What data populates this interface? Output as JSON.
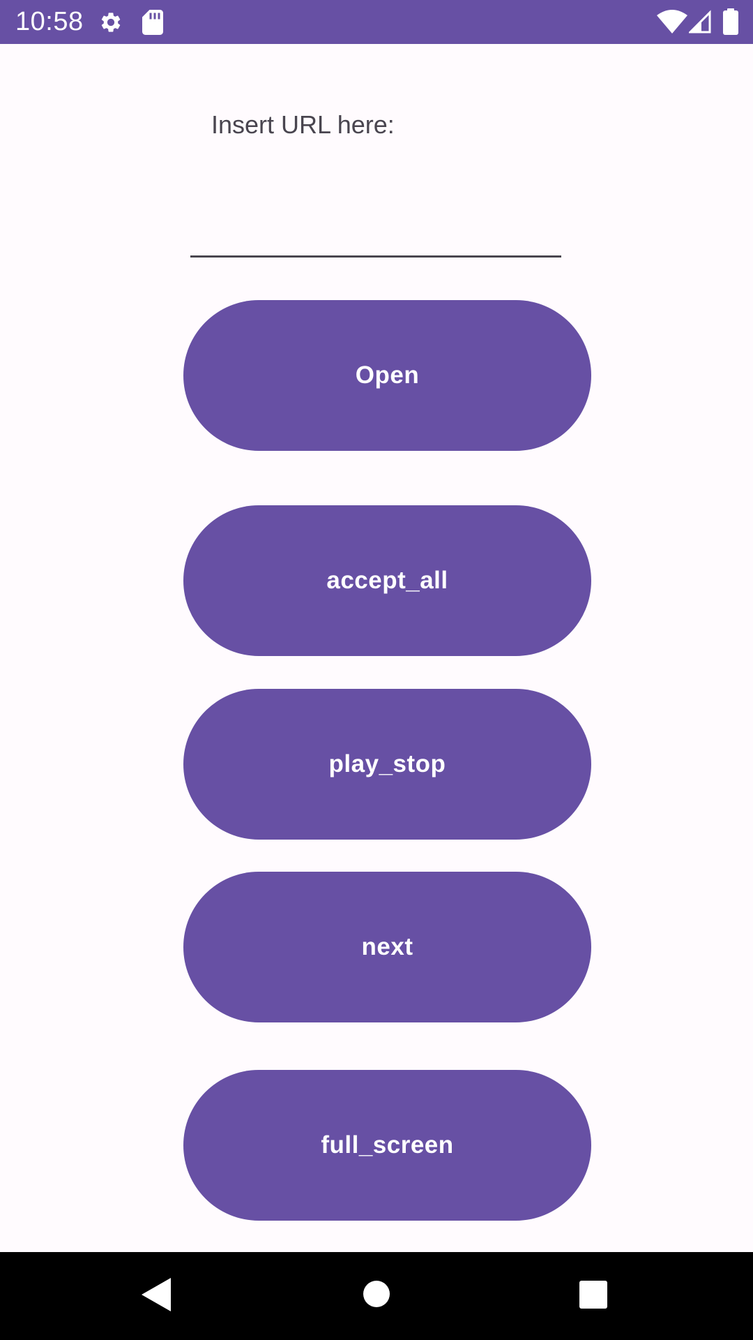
{
  "status_bar": {
    "time": "10:58",
    "background": "#6750a4",
    "icons": [
      "settings-icon",
      "sd-card-icon",
      "wifi-icon",
      "cell-signal-icon",
      "battery-icon"
    ]
  },
  "form": {
    "url_label": "Insert URL here:",
    "url_value": "",
    "url_placeholder": ""
  },
  "buttons": {
    "open": "Open",
    "accept_all": "accept_all",
    "play_stop": "play_stop",
    "next": "next",
    "full_screen": "full_screen"
  },
  "theme": {
    "primary": "#6750a4",
    "on_primary": "#ffffff",
    "background": "#fffbfe",
    "label_text": "#49454f"
  },
  "navigation_bar": {
    "icons": [
      "back-icon",
      "home-icon",
      "recents-icon"
    ]
  }
}
